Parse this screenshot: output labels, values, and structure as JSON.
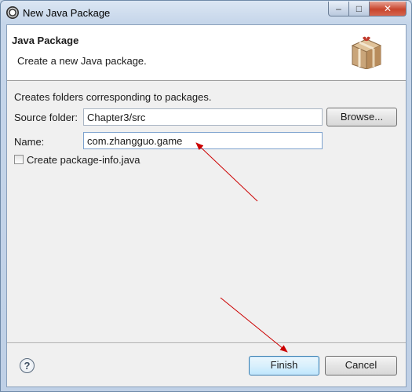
{
  "window": {
    "title": "New Java Package"
  },
  "caption_buttons": {
    "minimize": "–",
    "maximize": "□",
    "close": "✕"
  },
  "banner": {
    "title": "Java Package",
    "description": "Create a new Java package."
  },
  "form": {
    "description": "Creates folders corresponding to packages.",
    "source_folder": {
      "label": "Source folder:",
      "value": "Chapter3/src",
      "browse_label": "Browse..."
    },
    "name": {
      "label": "Name:",
      "value": "com.zhangguo.game"
    },
    "package_info": {
      "label": "Create package-info.java",
      "checked": false
    }
  },
  "footer": {
    "help_icon": "?",
    "finish_label": "Finish",
    "cancel_label": "Cancel"
  },
  "annotation": {
    "arrow_color": "#cc0000"
  },
  "icons": {
    "title": "eclipse-icon",
    "banner": "package-icon",
    "help": "help-icon"
  }
}
